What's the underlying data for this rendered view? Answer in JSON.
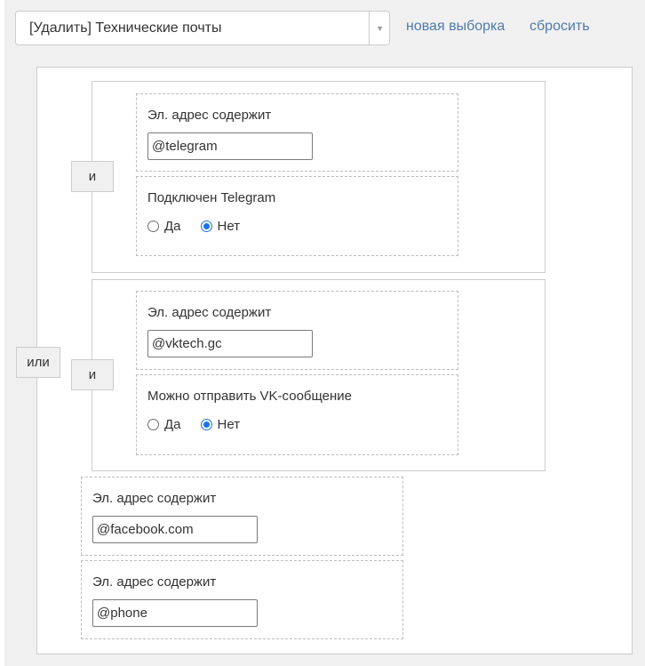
{
  "toolbar": {
    "select_value": "[Удалить] Технические почты",
    "select_arrow_icon": "triangle-down",
    "new_selection_link": "новая выборка",
    "reset_link": "сбросить"
  },
  "filter": {
    "root_operator": "или",
    "groups": [
      {
        "operator": "и",
        "conditions": [
          {
            "label": "Эл. адрес содержит",
            "value": "@telegram"
          },
          {
            "label": "Подключен Telegram",
            "options": [
              "Да",
              "Нет"
            ],
            "selected": "Нет"
          }
        ]
      },
      {
        "operator": "и",
        "conditions": [
          {
            "label": "Эл. адрес содержит",
            "value": "@vktech.gc"
          },
          {
            "label": "Можно отправить VK-сообщение",
            "options": [
              "Да",
              "Нет"
            ],
            "selected": "Нет"
          }
        ]
      }
    ],
    "conditions": [
      {
        "label": "Эл. адрес содержит",
        "value": "@facebook.com"
      },
      {
        "label": "Эл. адрес содержит",
        "value": "@phone"
      }
    ]
  }
}
